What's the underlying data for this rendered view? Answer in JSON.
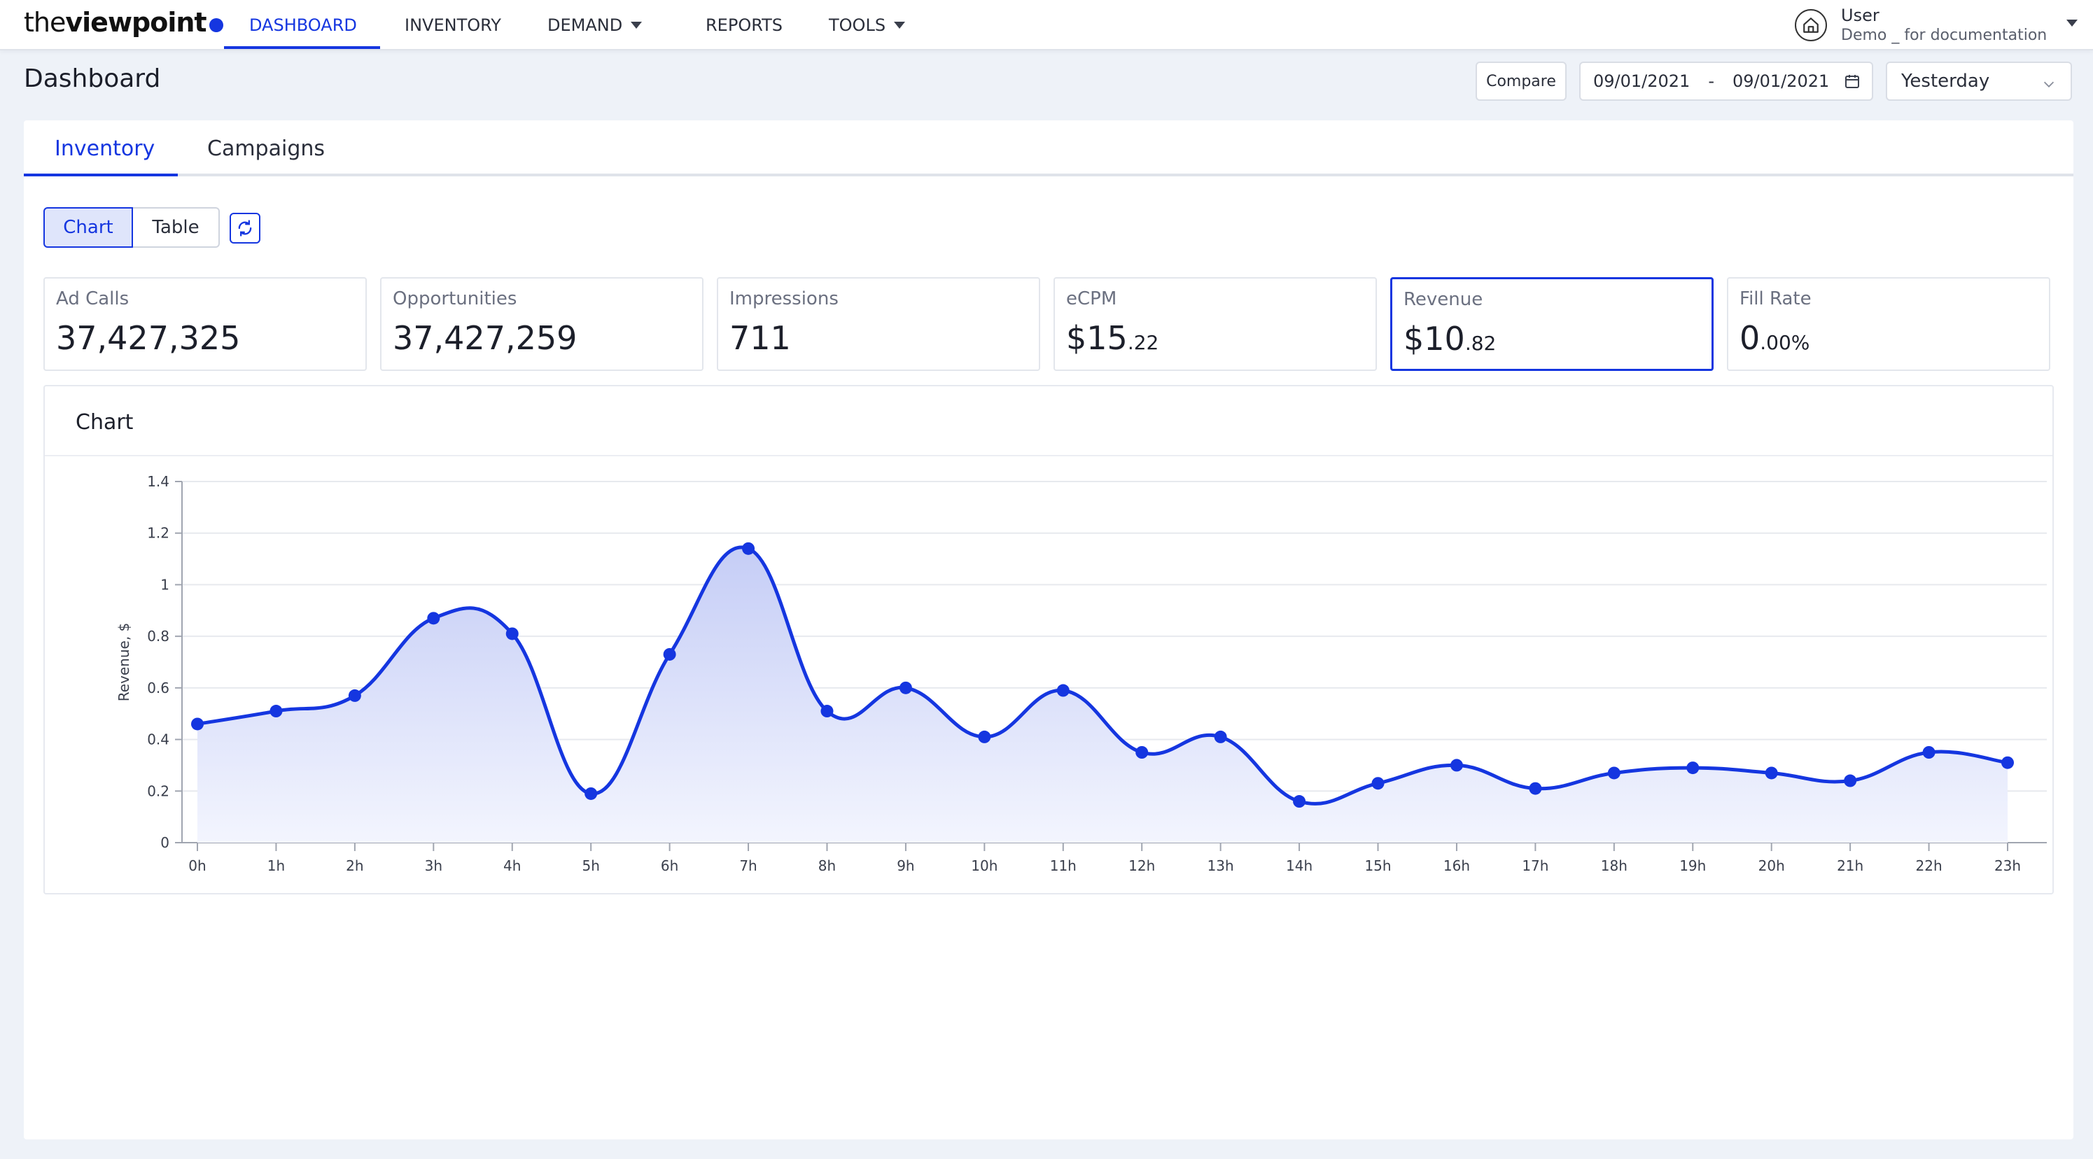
{
  "brand": {
    "logo_the": "the",
    "logo_viewpoint": "viewpoint",
    "accent": "#1536e0"
  },
  "nav": {
    "items": [
      {
        "label": "DASHBOARD",
        "active": true
      },
      {
        "label": "INVENTORY"
      },
      {
        "label": "DEMAND",
        "has_dropdown": true
      },
      {
        "label": "REPORTS"
      },
      {
        "label": "TOOLS",
        "has_dropdown": true
      }
    ]
  },
  "user": {
    "name": "User",
    "subtitle": "Demo _ for documentation",
    "icon": "home-icon"
  },
  "header": {
    "title": "Dashboard",
    "compare_label": "Compare",
    "date_from": "09/01/2021",
    "date_separator": "-",
    "date_to": "09/01/2021",
    "period": "Yesterday"
  },
  "tabs": [
    {
      "label": "Inventory",
      "active": true
    },
    {
      "label": "Campaigns"
    }
  ],
  "view_toggle": {
    "chart": "Chart",
    "table": "Table",
    "selected": "Chart"
  },
  "kpis": [
    {
      "label": "Ad Calls",
      "value": "37,427,325"
    },
    {
      "label": "Opportunities",
      "value": "37,427,259"
    },
    {
      "label": "Impressions",
      "value": "711"
    },
    {
      "label": "eCPM",
      "prefix": "$",
      "value_main": "15",
      "value_dec": ".22"
    },
    {
      "label": "Revenue",
      "prefix": "$",
      "value_main": "10",
      "value_dec": ".82",
      "selected": true
    },
    {
      "label": "Fill Rate",
      "value_main": "0",
      "value_dec": ".00%"
    }
  ],
  "chart_card": {
    "title": "Chart"
  },
  "chart_data": {
    "type": "area",
    "x": [
      "0h",
      "1h",
      "2h",
      "3h",
      "4h",
      "5h",
      "6h",
      "7h",
      "8h",
      "9h",
      "10h",
      "11h",
      "12h",
      "13h",
      "14h",
      "15h",
      "16h",
      "17h",
      "18h",
      "19h",
      "20h",
      "21h",
      "22h",
      "23h"
    ],
    "series": [
      {
        "values": [
          0.46,
          0.51,
          0.57,
          0.87,
          0.81,
          0.19,
          0.73,
          1.14,
          0.51,
          0.6,
          0.41,
          0.59,
          0.35,
          0.41,
          0.16,
          0.23,
          0.3,
          0.21,
          0.27,
          0.29,
          0.27,
          0.24,
          0.35,
          0.31
        ]
      }
    ],
    "ylabel": "Revenue, $",
    "xlabel": "",
    "ylim": [
      0,
      1.4
    ],
    "yticks": [
      "0",
      "0.2",
      "0.4",
      "0.6",
      "0.8",
      "1",
      "1.2",
      "1.4"
    ],
    "grid": true,
    "colors": {
      "line": "#1536e0",
      "fill_top": "#c5cdf6",
      "fill_bottom": "#f3f5fe",
      "grid": "#e7e9ee",
      "axis": "#a0a5b0"
    }
  }
}
